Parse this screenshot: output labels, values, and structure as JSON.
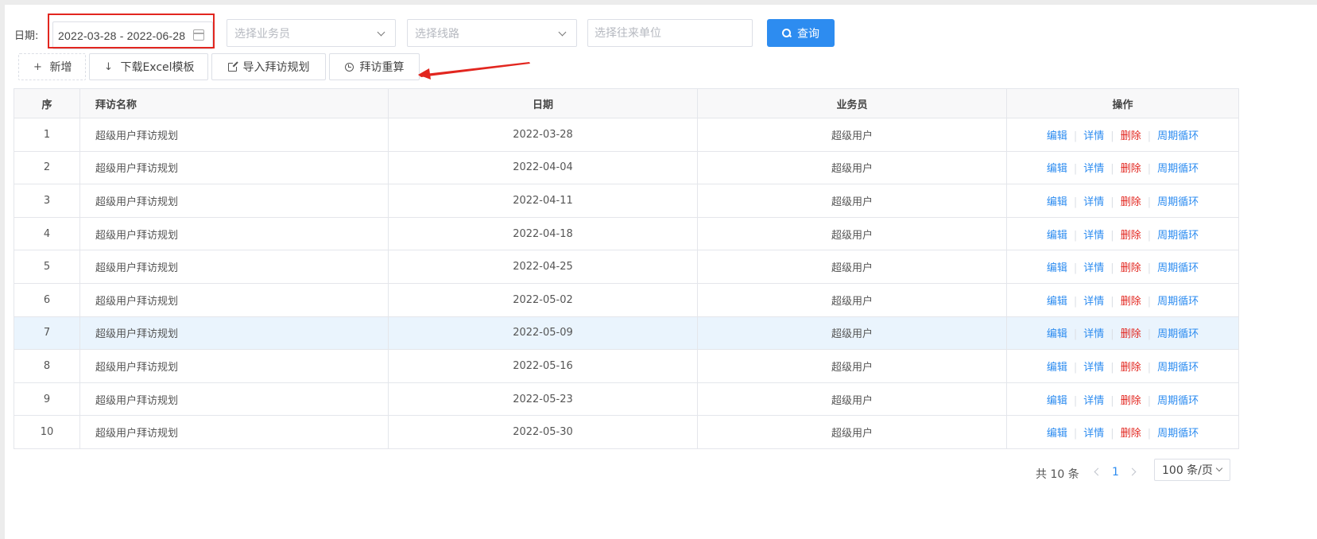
{
  "filters": {
    "date_label": "日期:",
    "date_range": "2022-03-28 - 2022-06-28",
    "salesperson_placeholder": "选择业务员",
    "route_placeholder": "选择线路",
    "company_placeholder": "选择往来单位",
    "query_label": "查询"
  },
  "toolbar": {
    "add_label": "新增",
    "download_label": "下载Excel模板",
    "import_label": "导入拜访规划",
    "recalc_label": "拜访重算"
  },
  "table": {
    "columns": [
      "序",
      "拜访名称",
      "日期",
      "业务员",
      "操作"
    ],
    "rows": [
      {
        "no": "1",
        "name": "超级用户拜访规划",
        "date": "2022-03-28",
        "salesperson": "超级用户"
      },
      {
        "no": "2",
        "name": "超级用户拜访规划",
        "date": "2022-04-04",
        "salesperson": "超级用户"
      },
      {
        "no": "3",
        "name": "超级用户拜访规划",
        "date": "2022-04-11",
        "salesperson": "超级用户"
      },
      {
        "no": "4",
        "name": "超级用户拜访规划",
        "date": "2022-04-18",
        "salesperson": "超级用户"
      },
      {
        "no": "5",
        "name": "超级用户拜访规划",
        "date": "2022-04-25",
        "salesperson": "超级用户"
      },
      {
        "no": "6",
        "name": "超级用户拜访规划",
        "date": "2022-05-02",
        "salesperson": "超级用户"
      },
      {
        "no": "7",
        "name": "超级用户拜访规划",
        "date": "2022-05-09",
        "salesperson": "超级用户"
      },
      {
        "no": "8",
        "name": "超级用户拜访规划",
        "date": "2022-05-16",
        "salesperson": "超级用户"
      },
      {
        "no": "9",
        "name": "超级用户拜访规划",
        "date": "2022-05-23",
        "salesperson": "超级用户"
      },
      {
        "no": "10",
        "name": "超级用户拜访规划",
        "date": "2022-05-30",
        "salesperson": "超级用户"
      }
    ],
    "actions": {
      "edit": "编辑",
      "detail": "详情",
      "delete": "删除",
      "cycle": "周期循环"
    },
    "highlighted_row": 7
  },
  "pagination": {
    "total": "共 10 条",
    "current_page": "1",
    "page_size": "100 条/页"
  },
  "colors": {
    "primary": "#2d8cf0",
    "danger": "#e2261f",
    "row_highlight": "#eaf4fd"
  }
}
